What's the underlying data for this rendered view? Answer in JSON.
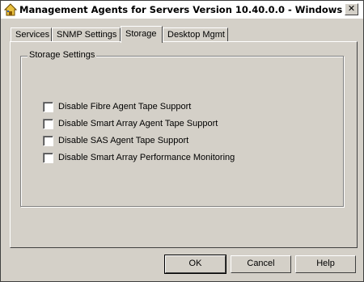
{
  "window": {
    "title": "Management Agents for Servers Version 10.40.0.0 - Windows",
    "close_glyph": "✕"
  },
  "tabs": [
    {
      "label": "Services",
      "active": false
    },
    {
      "label": "SNMP Settings",
      "active": false
    },
    {
      "label": "Storage",
      "active": true
    },
    {
      "label": "Desktop Mgmt",
      "active": false
    }
  ],
  "storage": {
    "group_label": "Storage Settings",
    "options": [
      {
        "label": "Disable Fibre Agent Tape Support",
        "checked": false
      },
      {
        "label": "Disable Smart Array Agent Tape Support",
        "checked": false
      },
      {
        "label": "Disable SAS Agent Tape Support",
        "checked": false
      },
      {
        "label": "Disable Smart Array Performance Monitoring",
        "checked": false
      }
    ]
  },
  "buttons": {
    "ok": "OK",
    "cancel": "Cancel",
    "help": "Help"
  },
  "icons": {
    "app": "house-icon",
    "close": "close-icon"
  }
}
